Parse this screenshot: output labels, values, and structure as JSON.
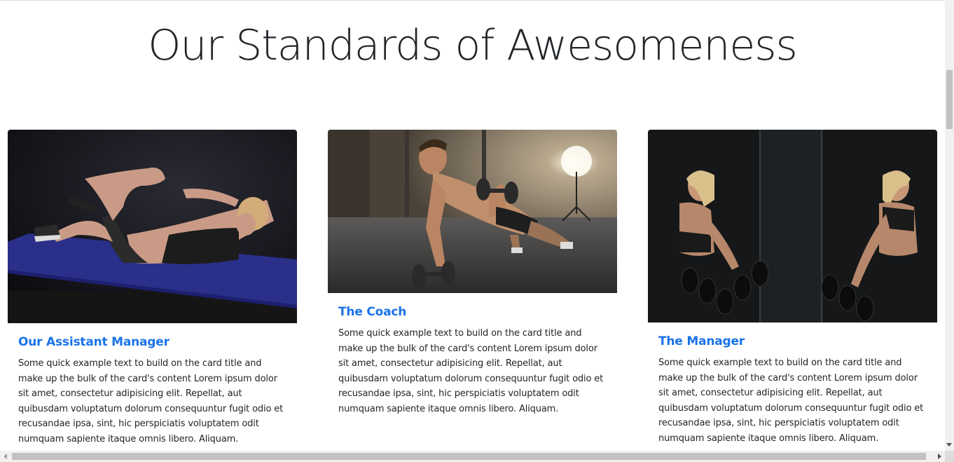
{
  "page": {
    "heading": "Our Standards of Awesomeness"
  },
  "cards": [
    {
      "image": "woman-doing-crunches-on-mat-photo",
      "title": "Our Assistant Manager",
      "text": "Some quick example text to build on the card title and make up the bulk of the card's content Lorem ipsum dolor sit amet, consectetur adipisicing elit. Repellat, aut quibusdam voluptatum dolorum consequuntur fugit odio et recusandae ipsa, sint, hic perspiciatis voluptatem odit numquam sapiente itaque omnis libero. Aliquam."
    },
    {
      "image": "man-doing-dumbbell-pushup-photo",
      "title": "The Coach",
      "text": "Some quick example text to build on the card title and make up the bulk of the card's content Lorem ipsum dolor sit amet, consectetur adipisicing elit. Repellat, aut quibusdam voluptatum dolorum consequuntur fugit odio et recusandae ipsa, sint, hic perspiciatis voluptatem odit numquam sapiente itaque omnis libero. Aliquam."
    },
    {
      "image": "woman-lifting-dumbbells-mirror-photo",
      "title": "The Manager",
      "text": "Some quick example text to build on the card title and make up the bulk of the card's content Lorem ipsum dolor sit amet, consectetur adipisicing elit. Repellat, aut quibusdam voluptatum dolorum consequuntur fugit odio et recusandae ipsa, sint, hic perspiciatis voluptatem odit numquam sapiente itaque omnis libero. Aliquam."
    }
  ],
  "colors": {
    "title_link": "#1a73e8",
    "text": "#212529",
    "scrollbar_track": "#f1f1f1",
    "scrollbar_thumb": "#c1c1c1"
  }
}
